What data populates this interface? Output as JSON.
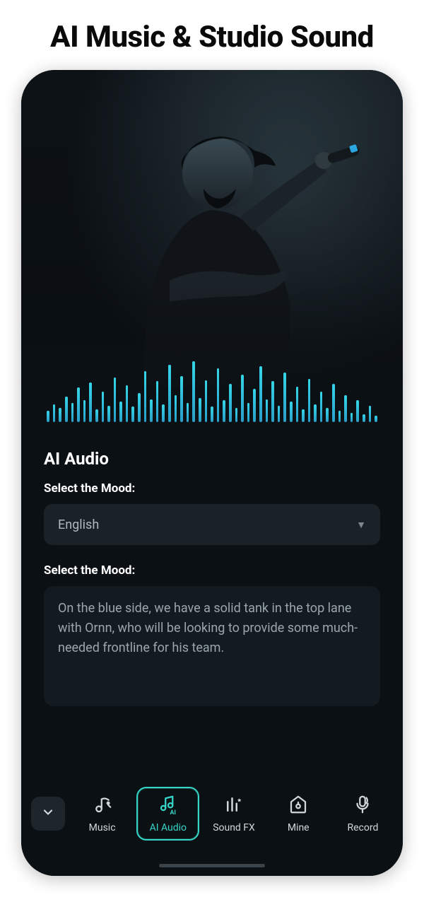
{
  "marketing": {
    "headline": "AI Music & Studio Sound"
  },
  "panel": {
    "title": "AI Audio",
    "mood_label": "Select the Mood:",
    "mood_select": {
      "value": "English"
    },
    "prompt_label": "Select the Mood:",
    "prompt_text": "On the blue side, we have a solid tank in the top lane with Ornn, who will be looking to provide some much-needed frontline for his team."
  },
  "tabs": {
    "items": [
      {
        "label": "Music",
        "icon": "music-note-icon",
        "active": false
      },
      {
        "label": "AI Audio",
        "icon": "ai-audio-icon",
        "active": true
      },
      {
        "label": "Sound FX",
        "icon": "equalizer-icon",
        "active": false
      },
      {
        "label": "Mine",
        "icon": "folder-icon",
        "active": false
      },
      {
        "label": "Record",
        "icon": "microphone-icon",
        "active": false
      }
    ]
  },
  "colors": {
    "accent": "#35d6c8",
    "wave": "#35d6e8",
    "bg": "#0b1014"
  }
}
